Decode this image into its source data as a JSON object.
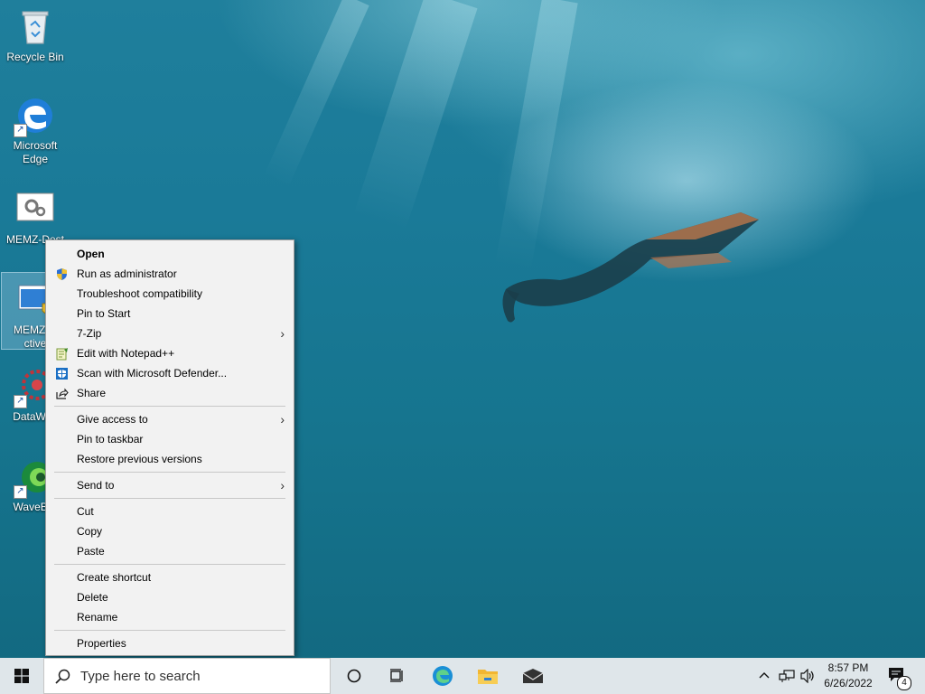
{
  "desktop": {
    "icons": [
      {
        "label": "Recycle Bin"
      },
      {
        "label": "Microsoft Edge"
      },
      {
        "label": "MEMZ-Dest"
      },
      {
        "label": "MEMZ-D ctive"
      },
      {
        "label": "DataWag"
      },
      {
        "label": "WaveBro"
      }
    ]
  },
  "context_menu": {
    "items": [
      {
        "label": "Open"
      },
      {
        "label": "Run as administrator",
        "icon": "shield-icon"
      },
      {
        "label": "Troubleshoot compatibility"
      },
      {
        "label": "Pin to Start"
      },
      {
        "label": "7-Zip"
      },
      {
        "label": "Edit with Notepad++",
        "icon": "notepad-icon"
      },
      {
        "label": "Scan with Microsoft Defender...",
        "icon": "defender-icon"
      },
      {
        "label": "Share",
        "icon": "share-icon"
      },
      {
        "label": "Give access to"
      },
      {
        "label": "Pin to taskbar"
      },
      {
        "label": "Restore previous versions"
      },
      {
        "label": "Send to"
      },
      {
        "label": "Cut"
      },
      {
        "label": "Copy"
      },
      {
        "label": "Paste"
      },
      {
        "label": "Create shortcut"
      },
      {
        "label": "Delete"
      },
      {
        "label": "Rename"
      },
      {
        "label": "Properties"
      }
    ]
  },
  "taskbar": {
    "search_placeholder": "Type here to search",
    "clock_time": "8:57 PM",
    "clock_date": "6/26/2022",
    "notification_count": "4"
  },
  "colors": {
    "menu_bg": "#f2f2f2",
    "taskbar_bg": "#dfe6ea",
    "accent": "#0078d7"
  }
}
